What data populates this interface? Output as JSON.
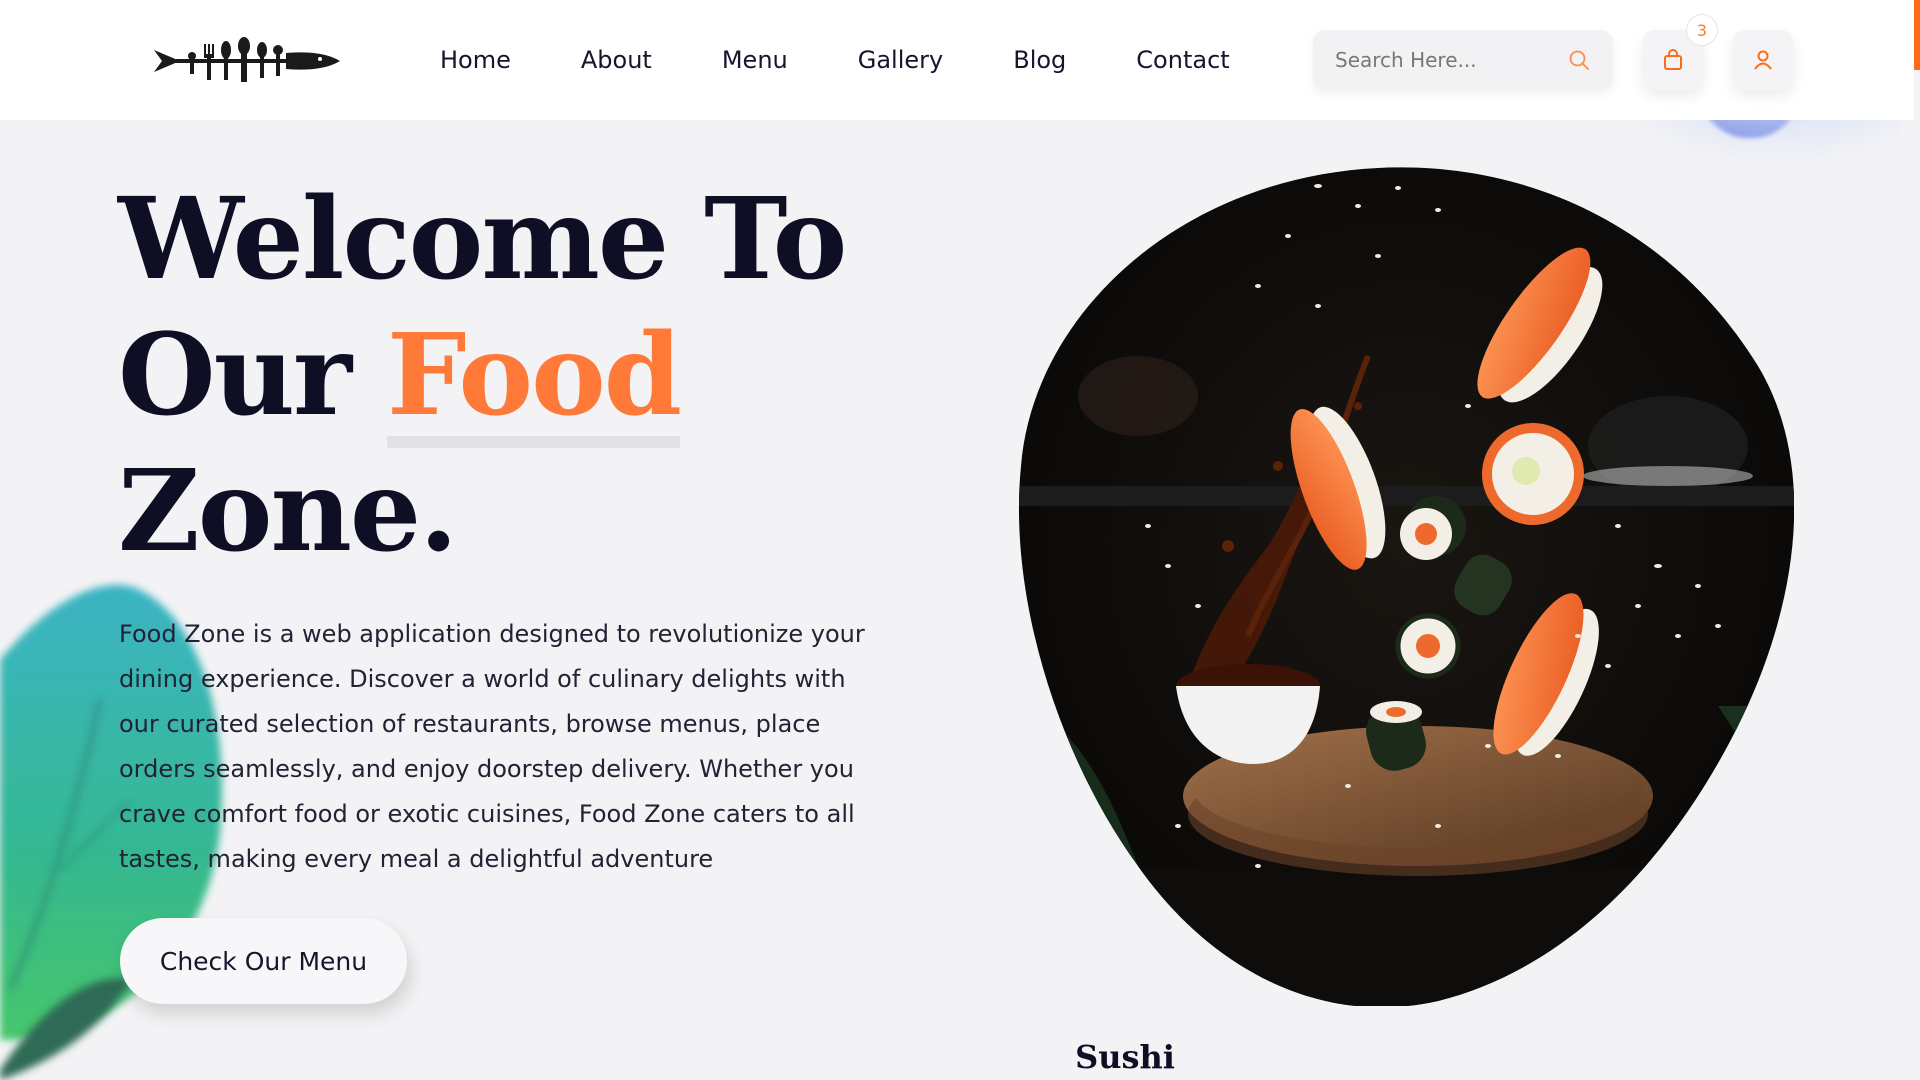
{
  "header": {
    "logo_name": "food-zone-logo",
    "nav": [
      {
        "label": "Home"
      },
      {
        "label": "About"
      },
      {
        "label": "Menu"
      },
      {
        "label": "Gallery"
      },
      {
        "label": "Blog"
      },
      {
        "label": "Contact"
      }
    ],
    "search": {
      "placeholder": "Search Here...",
      "value": "",
      "icon": "search-icon"
    },
    "cart": {
      "icon": "shopping-bag-icon",
      "count": "3"
    },
    "user": {
      "icon": "user-icon"
    }
  },
  "hero": {
    "title_line1": "Welcome To",
    "title_line2_prefix": "Our ",
    "title_line2_accent": "Food",
    "title_line3": "Zone.",
    "description": "Food Zone is a web application designed to revolutionize your dining experience. Discover a world of culinary delights with our curated selection of restaurants, browse menus, place orders seamlessly, and enjoy doorstep delivery. Whether you crave comfort food or exotic cuisines, Food Zone caters to all tastes, making every meal a delightful adventure",
    "cta_label": "Check Our Menu",
    "image": "sushi-splash-photo",
    "image_caption": "Sushi"
  },
  "colors": {
    "accent": "#ff7a38",
    "dark_text": "#0e0e25",
    "background": "#f3f3f5",
    "leaf": "#36b8a6"
  }
}
